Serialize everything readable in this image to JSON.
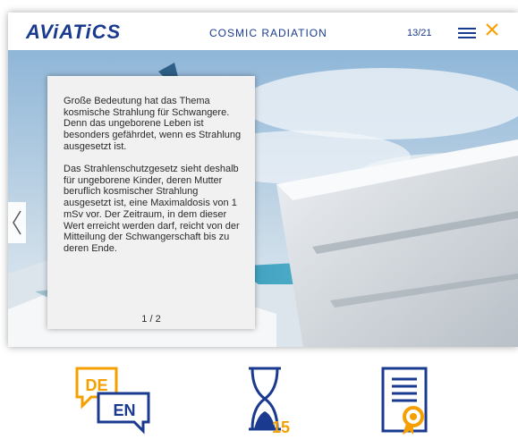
{
  "header": {
    "logo": "AViATiCS",
    "title": "COSMIC RADIATION",
    "page_counter": "13/21"
  },
  "content": {
    "paragraph_1": "Große Bedeutung hat das Thema kosmische Strahlung für Schwangere. Denn das ungeborene Leben ist besonders gefährdet, wenn es Strahlung ausgesetzt ist.",
    "paragraph_2": "Das Strahlenschutzgesetz sieht deshalb für ungeborene Kinder, deren Mutter beruflich kosmischer Strahlung ausgesetzt ist, eine Maximaldosis von 1 mSv vor. Der Zeitraum, in dem dieser Wert erreicht werden darf, reicht von der Mitteilung der Schwangerschaft bis zu deren Ende.",
    "pager": "1 / 2"
  },
  "toolbar": {
    "language_icon": {
      "top_label": "DE",
      "bottom_label": "EN"
    },
    "timer_icon": {
      "value": "15"
    },
    "certificate_icon": {}
  },
  "colors": {
    "brand_blue": "#1a3a8f",
    "accent_orange": "#f5a000",
    "panel_bg": "#f1f1f1"
  }
}
